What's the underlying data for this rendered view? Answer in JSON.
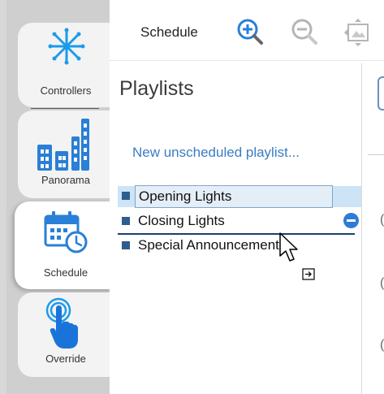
{
  "nav": {
    "items": [
      {
        "label": "Controllers",
        "icon": "starburst-icon"
      },
      {
        "label": "Panorama",
        "icon": "bar-chart-icon"
      },
      {
        "label": "Schedule",
        "icon": "calendar-clock-icon"
      },
      {
        "label": "Override",
        "icon": "touch-hand-icon"
      }
    ],
    "active": "Schedule"
  },
  "toolbar": {
    "title": "Schedule",
    "zoom_in_icon": "zoom-in-icon",
    "zoom_out_icon": "zoom-out-icon",
    "fit_icon": "fit-to-view-icon"
  },
  "playlists": {
    "heading": "Playlists",
    "new_link": "New unscheduled playlist...",
    "items": [
      {
        "name": "Opening Lights",
        "selected": true
      },
      {
        "name": "Closing Lights",
        "selected": false
      },
      {
        "name": "Special Announcement",
        "selected": false
      }
    ]
  },
  "colors": {
    "accent": "#2e7bd6",
    "link": "#3a7dc2",
    "selection": "#cde3f6"
  }
}
